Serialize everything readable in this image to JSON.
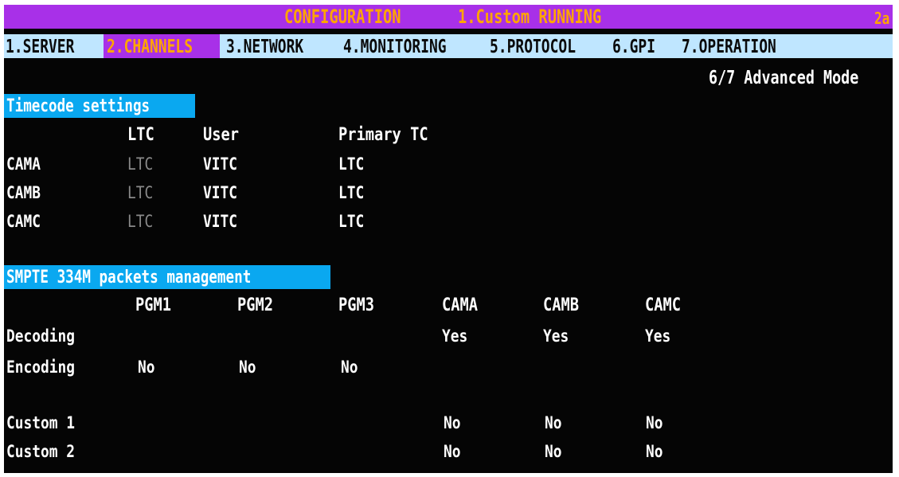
{
  "title_bar": {
    "title": "CONFIGURATION",
    "status": "1.Custom RUNNING",
    "corner": "2a"
  },
  "menu": {
    "items": [
      {
        "label": "1.SERVER"
      },
      {
        "label": "2.CHANNELS"
      },
      {
        "label": "3.NETWORK"
      },
      {
        "label": "4.MONITORING"
      },
      {
        "label": "5.PROTOCOL"
      },
      {
        "label": "6.GPI"
      },
      {
        "label": "7.OPERATION"
      }
    ],
    "active_index": 1
  },
  "page_indicator": "6/7 Advanced Mode",
  "timecode": {
    "title": "Timecode settings",
    "headers": [
      "LTC",
      "User",
      "Primary TC"
    ],
    "rows": [
      {
        "name": "CAMA",
        "ltc": "LTC",
        "user": "VITC",
        "primary": "LTC"
      },
      {
        "name": "CAMB",
        "ltc": "LTC",
        "user": "VITC",
        "primary": "LTC"
      },
      {
        "name": "CAMC",
        "ltc": "LTC",
        "user": "VITC",
        "primary": "LTC"
      }
    ]
  },
  "smpte": {
    "title": "SMPTE 334M packets management",
    "headers": [
      "PGM1",
      "PGM2",
      "PGM3",
      "CAMA",
      "CAMB",
      "CAMC"
    ],
    "rows": [
      {
        "label": "Decoding",
        "values": [
          "",
          "",
          "",
          "Yes",
          "Yes",
          "Yes"
        ]
      },
      {
        "label": "Encoding",
        "values": [
          "No",
          "No",
          "No",
          "",
          "",
          ""
        ]
      },
      {
        "label": "Custom 1",
        "values": [
          "",
          "",
          "",
          "No",
          "No",
          "No"
        ]
      },
      {
        "label": "Custom 2",
        "values": [
          "",
          "",
          "",
          "No",
          "No",
          "No"
        ]
      }
    ]
  },
  "colors": {
    "title_bar": "#a830e8",
    "menu_bar": "#bfe6ff",
    "section_header": "#0aa8f0",
    "active_menu_text": "#ffa500",
    "background": "#050505"
  }
}
